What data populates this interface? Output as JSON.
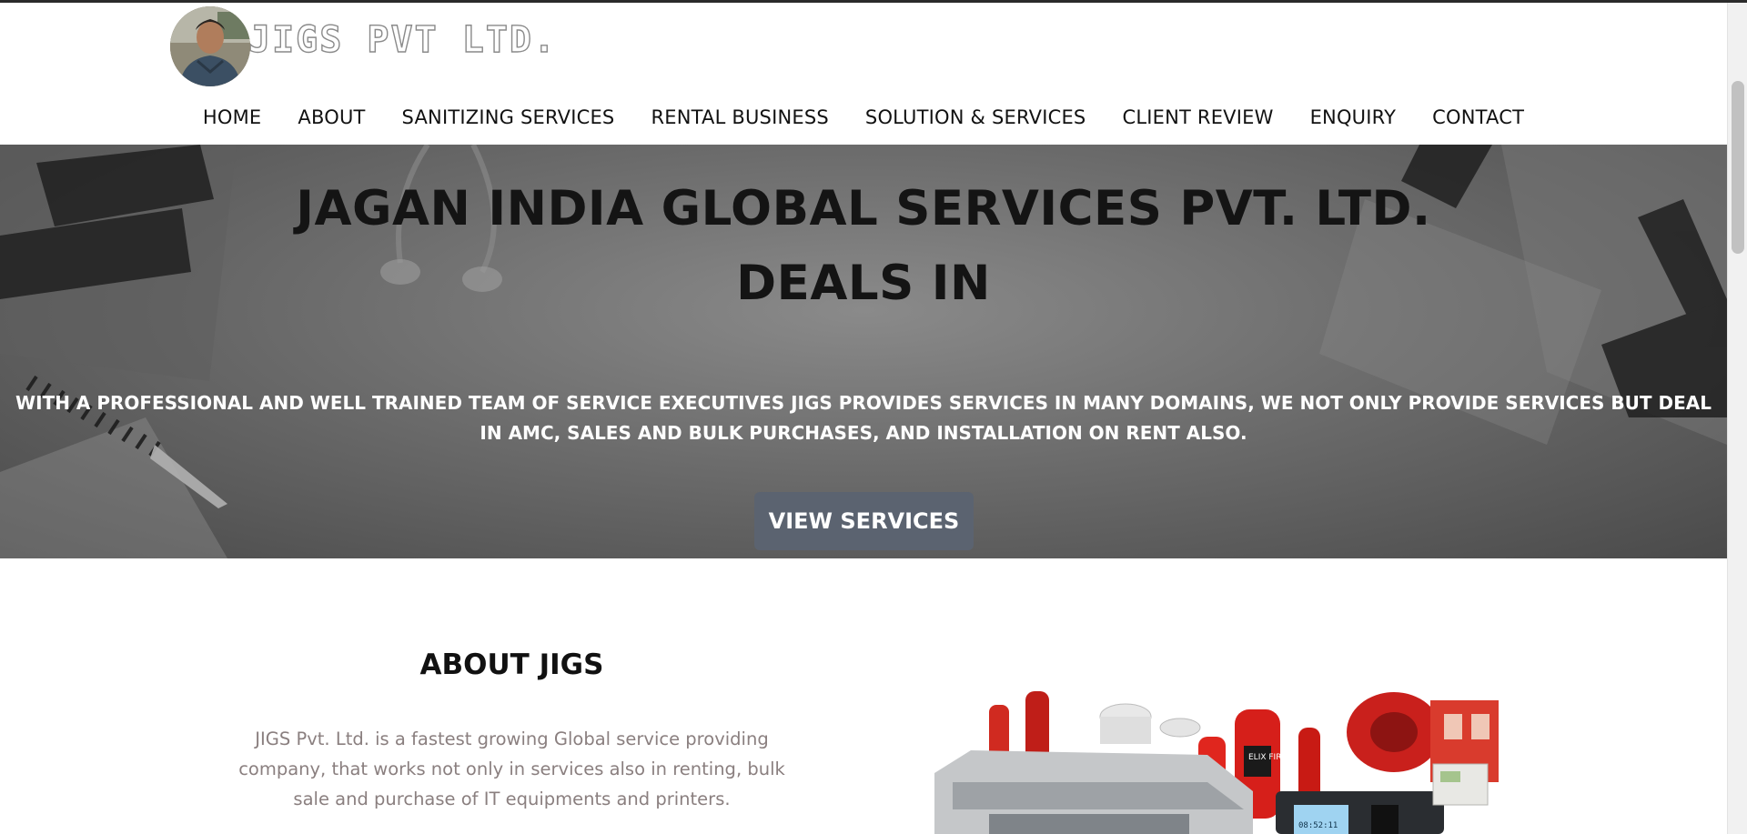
{
  "header": {
    "brand": "JIGS PVT LTD.",
    "avatar_icon": "profile-photo"
  },
  "nav": {
    "items": [
      {
        "label": "HOME"
      },
      {
        "label": "ABOUT"
      },
      {
        "label": "SANITIZING SERVICES"
      },
      {
        "label": "RENTAL BUSINESS"
      },
      {
        "label": "SOLUTION & SERVICES"
      },
      {
        "label": "CLIENT REVIEW"
      },
      {
        "label": "ENQUIRY"
      },
      {
        "label": "CONTACT"
      }
    ]
  },
  "hero": {
    "title_line1": "JAGAN INDIA GLOBAL SERVICES PVT. LTD.",
    "title_line2": "DEALS IN",
    "description": "WITH A PROFESSIONAL AND WELL TRAINED TEAM OF SERVICE EXECUTIVES JIGS PROVIDES SERVICES IN MANY DOMAINS, WE NOT ONLY PROVIDE SERVICES BUT DEAL IN AMC, SALES AND BULK PURCHASES, AND INSTALLATION ON RENT ALSO.",
    "button_label": "VIEW SERVICES",
    "button_color": "#5b6370"
  },
  "about": {
    "title": "ABOUT JIGS",
    "text": "JIGS Pvt. Ltd. is a fastest growing Global service providing company, that works not only in services also in renting, bulk sale and purchase of IT equipments and printers.",
    "image_label": "ELIX FIRE",
    "device_display": "08:52:11"
  }
}
